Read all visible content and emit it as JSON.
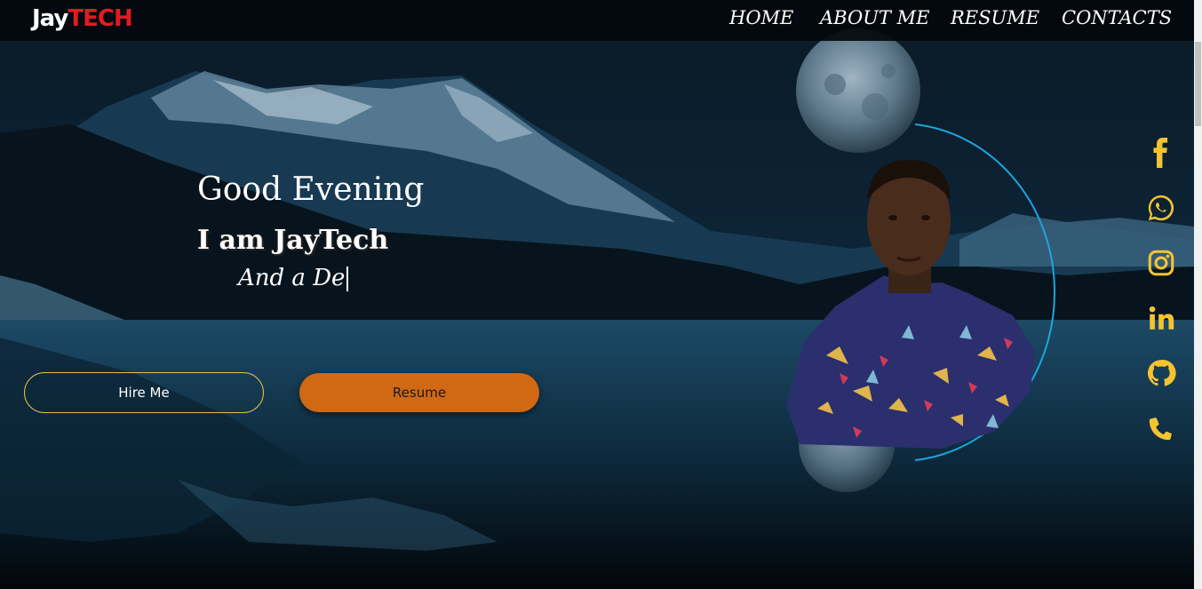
{
  "brand": {
    "part1": "Jay",
    "part2": "TECH"
  },
  "nav": [
    {
      "label": "HOME"
    },
    {
      "label": "ABOUT ME"
    },
    {
      "label": "RESUME"
    },
    {
      "label": "CONTACTS"
    }
  ],
  "hero": {
    "greeting": "Good Evening",
    "intro": "I am JayTech",
    "typing": "And a De"
  },
  "buttons": {
    "hire": "Hire Me",
    "resume": "Resume"
  },
  "social": [
    {
      "icon": "facebook-icon"
    },
    {
      "icon": "whatsapp-icon"
    },
    {
      "icon": "instagram-icon"
    },
    {
      "icon": "linkedin-icon"
    },
    {
      "icon": "github-icon"
    },
    {
      "icon": "phone-icon"
    }
  ],
  "colors": {
    "accent": "#e11b22",
    "social": "#f4c430",
    "resume_button": "#d06814",
    "hire_border": "#e7c23a",
    "ring": "#1aa6e0"
  }
}
